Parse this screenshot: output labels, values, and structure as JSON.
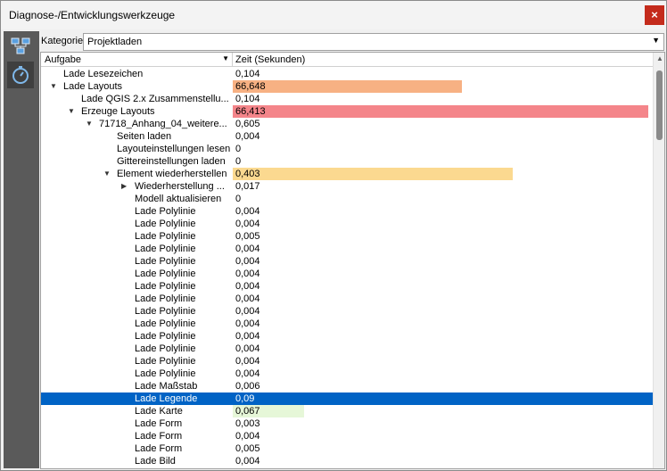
{
  "window": {
    "title": "Diagnose-/Entwicklungswerkzeuge",
    "close_glyph": "×"
  },
  "sidebar": {
    "items": [
      {
        "icon": "network-icon"
      },
      {
        "icon": "stopwatch-icon"
      }
    ]
  },
  "category": {
    "label": "Kategorie",
    "value": "Projektladen"
  },
  "table": {
    "col_task": "Aufgabe",
    "col_time": "Zeit (Sekunden)",
    "rows": [
      {
        "label": "Lade Lesezeichen",
        "value": "0,104"
      },
      {
        "label": "Lade Layouts",
        "value": "66,648",
        "bar_color": "#f7b183",
        "bar_frac": 0.55
      },
      {
        "label": "Lade QGIS 2.x Zusammenstellu...",
        "value": "0,104"
      },
      {
        "label": "Erzeuge Layouts",
        "value": "66,413",
        "bar_color": "#f4858a",
        "bar_frac": 0.995
      },
      {
        "label": "71718_Anhang_04_weitere...",
        "value": "0,605"
      },
      {
        "label": "Seiten laden",
        "value": "0,004"
      },
      {
        "label": "Layouteinstellungen lesen",
        "value": "0"
      },
      {
        "label": "Gittereinstellungen laden",
        "value": "0"
      },
      {
        "label": "Element wiederherstellen",
        "value": "0,403",
        "bar_color": "#fbd990",
        "bar_frac": 0.67
      },
      {
        "label": "Wiederherstellung ...",
        "value": "0,017"
      },
      {
        "label": "Modell aktualisieren",
        "value": "0"
      },
      {
        "label": "Lade Polylinie",
        "value": "0,004"
      },
      {
        "label": "Lade Polylinie",
        "value": "0,004"
      },
      {
        "label": "Lade Polylinie",
        "value": "0,005"
      },
      {
        "label": "Lade Polylinie",
        "value": "0,004"
      },
      {
        "label": "Lade Polylinie",
        "value": "0,004"
      },
      {
        "label": "Lade Polylinie",
        "value": "0,004"
      },
      {
        "label": "Lade Polylinie",
        "value": "0,004"
      },
      {
        "label": "Lade Polylinie",
        "value": "0,004"
      },
      {
        "label": "Lade Polylinie",
        "value": "0,004"
      },
      {
        "label": "Lade Polylinie",
        "value": "0,004"
      },
      {
        "label": "Lade Polylinie",
        "value": "0,004"
      },
      {
        "label": "Lade Polylinie",
        "value": "0,004"
      },
      {
        "label": "Lade Polylinie",
        "value": "0,004"
      },
      {
        "label": "Lade Polylinie",
        "value": "0,004"
      },
      {
        "label": "Lade Maßstab",
        "value": "0,006"
      },
      {
        "label": "Lade Legende",
        "value": "0,09",
        "selected": true
      },
      {
        "label": "Lade Karte",
        "value": "0,067",
        "bar_color": "#e6f7d8",
        "bar_frac": 0.17
      },
      {
        "label": "Lade Form",
        "value": "0,003"
      },
      {
        "label": "Lade Form",
        "value": "0,004"
      },
      {
        "label": "Lade Form",
        "value": "0,005"
      },
      {
        "label": "Lade Bild",
        "value": "0,004"
      }
    ]
  }
}
